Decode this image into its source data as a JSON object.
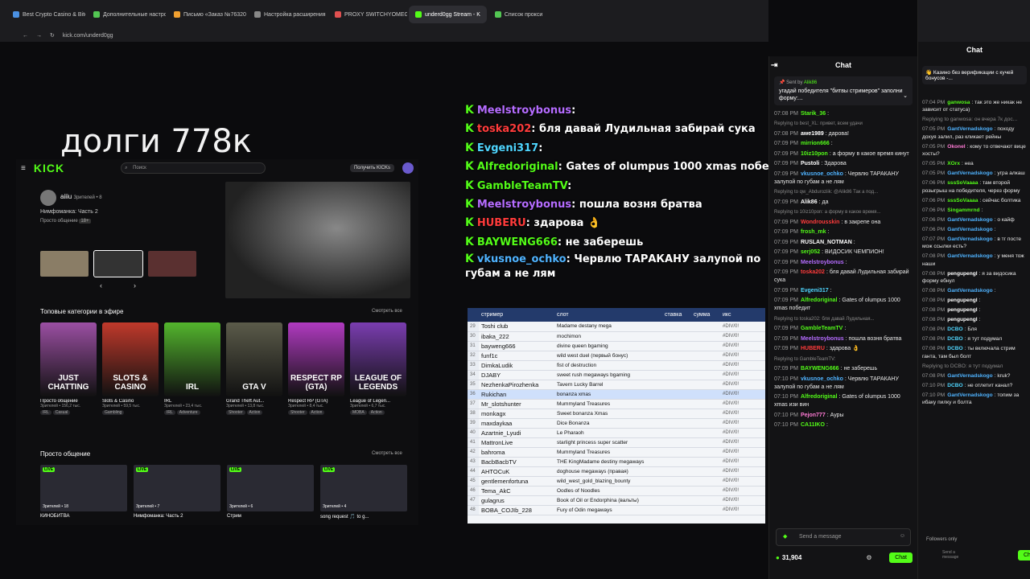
{
  "browser": {
    "tabs": [
      {
        "label": "Best Crypto Casino & Bitco",
        "color": "#4a90e2"
      },
      {
        "label": "Дополнительные настро",
        "color": "#53c653"
      },
      {
        "label": "Письмо «Заказ №76320",
        "color": "#f0a030"
      },
      {
        "label": "Настройка расширения",
        "color": "#888888"
      },
      {
        "label": "PROXY SWITCHYOMEGA",
        "color": "#e05050"
      },
      {
        "label": "underd0gg Stream - K",
        "color": "#53fc18",
        "active": true
      },
      {
        "label": "Список прокси",
        "color": "#53c653"
      }
    ],
    "url": "kick.com/underd0gg"
  },
  "overlay_title": "долги 778к",
  "kick_page": {
    "search_placeholder": "Поиск",
    "get_kicks": "Получить KICKs",
    "featured": {
      "name": "aiiiu",
      "viewers": "Зрителей • 8",
      "title": "Нимфоманка: Часть 2",
      "category": "Просто общение",
      "age": "18+"
    },
    "top_categories_title": "Топовые категории в эфире",
    "see_all": "Смотреть все",
    "categories": [
      {
        "name": "Просто общение",
        "viewers": "Зрителей • 156,2 тыс.",
        "img_text": "JUST CHATTING",
        "color": "#9b4fa3",
        "tags": [
          "IRL",
          "Casual"
        ]
      },
      {
        "name": "Slots & Casino",
        "viewers": "Зрителей • 59,5 тыс.",
        "img_text": "SLOTS & CASINO",
        "color": "#c0392b",
        "tags": [
          "Gambling"
        ]
      },
      {
        "name": "IRL",
        "viewers": "Зрителей • 23,4 тыс.",
        "img_text": "IRL",
        "color": "#53b52d",
        "tags": [
          "IRL",
          "Adventure"
        ]
      },
      {
        "name": "Grand Theft Aut...",
        "viewers": "Зрителей • 13,8 тыс.",
        "img_text": "GTA V",
        "color": "#5b5b4a",
        "tags": [
          "Shooter",
          "Action"
        ]
      },
      {
        "name": "Respect RP (GTA)",
        "viewers": "Зрителей • 8,4 тыс.",
        "img_text": "RESPECT RP (GTA)",
        "color": "#b03ac0",
        "tags": [
          "Shooter",
          "Action"
        ]
      },
      {
        "name": "League of Legen...",
        "viewers": "Зрителей • 6,7 тыс.",
        "img_text": "LEAGUE OF LEGENDS",
        "color": "#7a3db0",
        "tags": [
          "MOBA",
          "Action"
        ]
      }
    ],
    "just_chatting_title": "Просто общение",
    "streams": [
      {
        "name": "КИНОБИТВА",
        "viewers": "Зрителей • 18"
      },
      {
        "name": "Нимфоманка: Часть 2",
        "viewers": "Зрителей • 7"
      },
      {
        "name": "Стрим",
        "viewers": "Зрителей • 6"
      },
      {
        "name": "song request 🎵 to g...",
        "viewers": "Зрителей • 4"
      }
    ]
  },
  "overlay_chat": [
    {
      "user": "Meelstroybonus",
      "color": "#b56cff",
      "msg": ""
    },
    {
      "user": "toska202",
      "color": "#ff3b3b",
      "msg": "бля давай Лудильная забирай сука"
    },
    {
      "user": "Evgeni317",
      "color": "#4fd6ff",
      "msg": ""
    },
    {
      "user": "Alfredoriginal",
      "color": "#53fc18",
      "msg": "Gates of olumpus 1000 xmas победит"
    },
    {
      "user": "GambleTeamTV",
      "color": "#53fc18",
      "msg": ""
    },
    {
      "user": "Meelstroybonus",
      "color": "#b56cff",
      "msg": "пошла возня братва"
    },
    {
      "user": "HUBERU",
      "color": "#ff3b3b",
      "msg": "здарова 👌"
    },
    {
      "user": "BAYWENG666",
      "color": "#53fc18",
      "msg": "не заберешь"
    },
    {
      "user": "vkusnoe_ochko",
      "color": "#4fb3ff",
      "msg": "Червлю ТАРАКАНУ залупой по губам а не лям"
    }
  ],
  "sheet": {
    "headers": [
      "",
      "стример",
      "слот",
      "ставка",
      "сумма",
      "икс"
    ],
    "rows": [
      {
        "n": "29",
        "name": "Toshi club",
        "slot": "Madame destany mega",
        "x": "#DIV/0!"
      },
      {
        "n": "30",
        "name": "ibaka_222",
        "slot": "mochimon",
        "x": "#DIV/0!"
      },
      {
        "n": "31",
        "name": "bayweng666",
        "slot": "divine queen bgaming",
        "x": "#DIV/0!"
      },
      {
        "n": "32",
        "name": "funf1c",
        "slot": "wild west duel (первый бонус)",
        "x": "#DIV/0!"
      },
      {
        "n": "33",
        "name": "DimkaLudik",
        "slot": "fist of destruction",
        "x": "#DIV/0!"
      },
      {
        "n": "34",
        "name": "DJABY",
        "slot": "sweet rush megaways bgaming",
        "x": "#DIV/0!"
      },
      {
        "n": "35",
        "name": "NezhenkaPirozhenka",
        "slot": "Tavern Lucky Barrel",
        "x": "#DIV/0!"
      },
      {
        "n": "36",
        "name": "Rukichan",
        "slot": "bonanza xmas",
        "x": "#DIV/0!",
        "sel": true
      },
      {
        "n": "37",
        "name": "Mr_slotshunter",
        "slot": "Mummyland Treasures",
        "x": "#DIV/0!"
      },
      {
        "n": "38",
        "name": "monkagx",
        "slot": "Sweet bonanza Xmas",
        "x": "#DIV/0!"
      },
      {
        "n": "39",
        "name": "maxdaykaa",
        "slot": "Dice Bonanza",
        "x": "#DIV/0!"
      },
      {
        "n": "40",
        "name": "Azartnie_Lyudi",
        "slot": "Le Pharaoh",
        "x": "#DIV/0!"
      },
      {
        "n": "41",
        "name": "MattronLive",
        "slot": "starlight princess super scatter",
        "x": "#DIV/0!"
      },
      {
        "n": "42",
        "name": "bahroma",
        "slot": "Mummyland Treasures",
        "x": "#DIV/0!"
      },
      {
        "n": "43",
        "name": "BacbBacbTV",
        "slot": "THE KingMadame destiny megaways",
        "x": "#DIV/0!"
      },
      {
        "n": "44",
        "name": "AHTOCuK",
        "slot": "doghouse megaways (правая)",
        "x": "#DIV/0!"
      },
      {
        "n": "45",
        "name": "gentlemenfortuna",
        "slot": "wild_west_gold_blazing_bounty",
        "x": "#DIV/0!"
      },
      {
        "n": "46",
        "name": "Tema_AkC",
        "slot": "Oodles of Noodles",
        "x": "#DIV/0!"
      },
      {
        "n": "47",
        "name": "gulagrus",
        "slot": "Book of Oil or Endorphina (вальты)",
        "x": "#DIV/0!"
      },
      {
        "n": "48",
        "name": "BOBA_COJIb_228",
        "slot": "Fury of Odin megaways",
        "x": "#DIV/0!"
      }
    ]
  },
  "chat": {
    "title": "Chat",
    "pinned_by": "Sent by",
    "pinned_user": "Alik86",
    "pinned_text": "угадай победителя \"битвы стримеров\" заполни форму:...",
    "messages": [
      {
        "t": "07:08 PM",
        "u": "Starik_36",
        "c": "#53fc18",
        "m": ""
      },
      {
        "reply": "Replying to best_XL: привет, всем удачи"
      },
      {
        "t": "07:08 PM",
        "u": "awe1989",
        "c": "#ffffff",
        "m": "дарова!"
      },
      {
        "t": "07:09 PM",
        "u": "mirrion666",
        "c": "#53fc18",
        "m": ""
      },
      {
        "t": "07:09 PM",
        "u": "10iz10pon",
        "c": "#53fc18",
        "m": "а форму в какое время кинут"
      },
      {
        "t": "07:09 PM",
        "u": "Pustoli",
        "c": "#ffffff",
        "m": "Здарова"
      },
      {
        "t": "07:09 PM",
        "u": "vkusnoe_ochko",
        "c": "#4fb3ff",
        "m": "Червлю ТАРАКАНУ залупой по губам а не лям"
      },
      {
        "reply": "Replying to qw_Abduroziik: @Alik86 Так а под..."
      },
      {
        "t": "07:09 PM",
        "u": "Alik86",
        "c": "#ffffff",
        "m": "да"
      },
      {
        "reply": "Replying to 10iz10pon: а форму в какое время..."
      },
      {
        "t": "07:09 PM",
        "u": "Wondrousskin",
        "c": "#ff3b3b",
        "m": "в закрепе она"
      },
      {
        "t": "07:09 PM",
        "u": "frosh_mk",
        "c": "#53fc18",
        "m": ""
      },
      {
        "t": "07:09 PM",
        "u": "RUSLAN_NOTMAN",
        "c": "#ffffff",
        "m": ""
      },
      {
        "t": "07:09 PM",
        "u": "serj052",
        "c": "#53fc18",
        "m": "ВИДОСИК ЧЕМПИОН!"
      },
      {
        "t": "07:09 PM",
        "u": "Meelstroybonus",
        "c": "#b56cff",
        "m": ""
      },
      {
        "t": "07:09 PM",
        "u": "toska202",
        "c": "#ff3b3b",
        "m": "бля давай Лудильная забирай сука"
      },
      {
        "t": "07:09 PM",
        "u": "Evgeni317",
        "c": "#4fd6ff",
        "m": ""
      },
      {
        "t": "07:09 PM",
        "u": "Alfredoriginal",
        "c": "#53fc18",
        "m": "Gates of olumpus 1000 xmas победит"
      },
      {
        "reply": "Replying to toska202: бля давай Лудильная..."
      },
      {
        "t": "07:09 PM",
        "u": "GambleTeamTV",
        "c": "#53fc18",
        "m": ""
      },
      {
        "t": "07:09 PM",
        "u": "Meelstroybonus",
        "c": "#b56cff",
        "m": "пошла возня братва"
      },
      {
        "t": "07:09 PM",
        "u": "HUBERU",
        "c": "#ff3b3b",
        "m": "здарова 👌"
      },
      {
        "reply": "Replying to GambleTeamTV:"
      },
      {
        "t": "07:09 PM",
        "u": "BAYWENG666",
        "c": "#53fc18",
        "m": "не заберешь"
      },
      {
        "t": "07:10 PM",
        "u": "vkusnoe_ochko",
        "c": "#4fb3ff",
        "m": "Червлю ТАРАКАНУ залупой по губам а не лям"
      },
      {
        "t": "07:10 PM",
        "u": "Alfredoriginal",
        "c": "#53fc18",
        "m": "Gates of olumpus 1000 xmas изи вин"
      },
      {
        "t": "07:10 PM",
        "u": "Pejon777",
        "c": "#ff7bd5",
        "m": "Ауры"
      },
      {
        "t": "07:10 PM",
        "u": "CA11IKO",
        "c": "#53fc18",
        "m": ""
      }
    ],
    "input_placeholder": "Send a message",
    "points": "31,904",
    "send_label": "Chat"
  },
  "right_chat": {
    "title": "Chat",
    "pinned_text": "👋 Казино без верификации с кучей бонусов -...",
    "followers_only": "Followers only",
    "send_label": "Chat",
    "input_placeholder": "Send a message",
    "messages": [
      {
        "t": "07:04 PM",
        "u": "ganwosa",
        "c": "#53fc18",
        "m": "так это же никак не зависит от статуса)"
      },
      {
        "reply": "Replying to ganwosa: он вчера 7к дос..."
      },
      {
        "t": "07:05 PM",
        "u": "GantVernadskogo",
        "c": "#4fb3ff",
        "m": "походу дохуя залил, раз кликает рейны"
      },
      {
        "t": "07:05 PM",
        "u": "Okonel",
        "c": "#ff7bd5",
        "m": "кому то отвечают вице хосты?"
      },
      {
        "t": "07:05 PM",
        "u": "XOrx",
        "c": "#53fc18",
        "m": "неа"
      },
      {
        "t": "07:05 PM",
        "u": "GantVernadskogo",
        "c": "#4fb3ff",
        "m": "угра алкаш"
      },
      {
        "t": "07:06 PM",
        "u": "sssSoVaaaa",
        "c": "#53fc18",
        "m": "там второй розыгрыш на победителя, через форму"
      },
      {
        "t": "07:06 PM",
        "u": "sssSoVaaaa",
        "c": "#53fc18",
        "m": "сейчас болтика"
      },
      {
        "t": "07:06 PM",
        "u": "Singammrnd",
        "c": "#53fc18",
        "m": ""
      },
      {
        "t": "07:06 PM",
        "u": "GantVernadskogo",
        "c": "#4fb3ff",
        "m": "о кайф"
      },
      {
        "t": "07:06 PM",
        "u": "GantVernadskogo",
        "c": "#4fb3ff",
        "m": ""
      },
      {
        "t": "07:07 PM",
        "u": "GantVernadskogo",
        "c": "#4fb3ff",
        "m": "в тг посте мож ссылки есть?"
      },
      {
        "t": "07:08 PM",
        "u": "GantVernadskogo",
        "c": "#4fb3ff",
        "m": "у меня тож наши"
      },
      {
        "t": "07:08 PM",
        "u": "pengupengl",
        "c": "#ffffff",
        "m": "я за видосика форму ебнул"
      },
      {
        "t": "07:08 PM",
        "u": "GantVernadskogo",
        "c": "#4fb3ff",
        "m": ""
      },
      {
        "t": "07:08 PM",
        "u": "pengupengl",
        "c": "#ffffff",
        "m": ""
      },
      {
        "t": "07:08 PM",
        "u": "pengupengl",
        "c": "#ffffff",
        "m": ""
      },
      {
        "t": "07:08 PM",
        "u": "pengupengl",
        "c": "#ffffff",
        "m": ""
      },
      {
        "t": "07:08 PM",
        "u": "DCBO",
        "c": "#4fd6ff",
        "m": "Бля"
      },
      {
        "t": "07:08 PM",
        "u": "DCBO",
        "c": "#4fd6ff",
        "m": "я тут подумал"
      },
      {
        "t": "07:08 PM",
        "u": "DCBO",
        "c": "#4fd6ff",
        "m": "ты включала стрим ганта, там был болт"
      },
      {
        "reply": "Replying to DCBO: я тут подумал"
      },
      {
        "t": "07:08 PM",
        "u": "GantVernadskogo",
        "c": "#4fb3ff",
        "m": "kruk?"
      },
      {
        "t": "07:10 PM",
        "u": "DCBO",
        "c": "#4fd6ff",
        "m": "не отлетит канал?"
      },
      {
        "t": "07:10 PM",
        "u": "GantVernadskogo",
        "c": "#4fb3ff",
        "m": "топим за ибаку пилку и болта"
      }
    ]
  }
}
